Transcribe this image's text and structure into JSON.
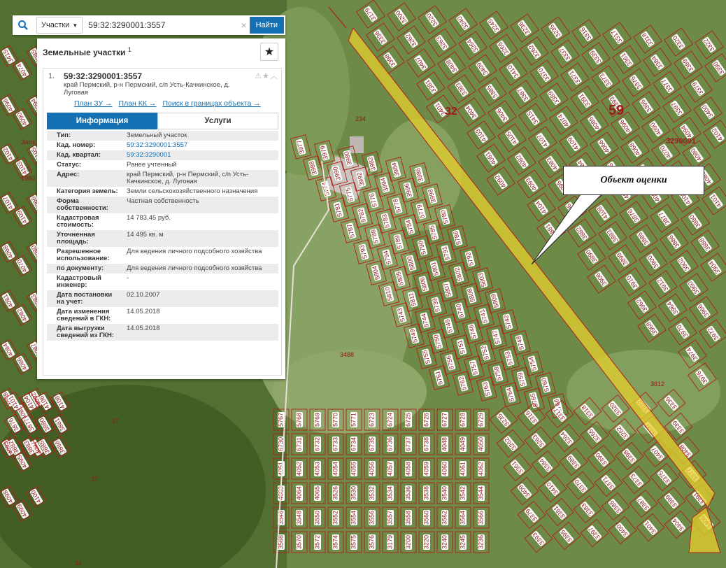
{
  "map": {
    "labels": {
      "quarter_32": "32",
      "quarter_59": "59",
      "quarter_code": "3290001",
      "parcel_234": "234",
      "parcel_3488": "3488",
      "parcel_3812": "3812",
      "parcel_37a": "37",
      "parcel_37b": "37",
      "parcel_34": "34",
      "parcel_5": "5",
      "parcel_1980": "1980",
      "parcel_zaoz": "Заоз"
    },
    "parcel_numbers": [
      "3179",
      "3200",
      "3220",
      "3240",
      "3245",
      "3236",
      "3235",
      "3316",
      "3317",
      "3318",
      "3320",
      "3322",
      "3336",
      "3262",
      "3263",
      "3264",
      "3265",
      "3262",
      "3337",
      "3339",
      "3361",
      "3384",
      "3389",
      "3390",
      "3398",
      "3407",
      "3408",
      "3409",
      "3410",
      "3370",
      "3371",
      "3373",
      "3375",
      "3377",
      "3379",
      "3381",
      "3383",
      "3385",
      "3387",
      "3389",
      "3391",
      "3393",
      "3395",
      "3397",
      "3400",
      "3401",
      "3404",
      "3406",
      "3415",
      "4074",
      "4085",
      "4096",
      "4090",
      "4094",
      "4102",
      "4103",
      "4105",
      "4107",
      "4109",
      "4066",
      "4068",
      "4070",
      "4080",
      "4081",
      "4082",
      "4083",
      "4084",
      "4086",
      "4087",
      "4088",
      "4089",
      "4092",
      "4093",
      "4095",
      "4097",
      "4098",
      "4099",
      "4100",
      "4101",
      "4104",
      "4106",
      "4108",
      "3876",
      "3877",
      "3880",
      "3881",
      "3882",
      "3883",
      "3885",
      "3886",
      "3888",
      "3890",
      "3898",
      "3900",
      "3902",
      "3904",
      "3906",
      "3910",
      "3912",
      "3960",
      "3962",
      "3964",
      "3966",
      "3968",
      "3970",
      "3972",
      "3974",
      "3976",
      "3977",
      "3979",
      "3980",
      "3982",
      "3984",
      "3986",
      "3988",
      "3990",
      "3992",
      "3994",
      "3996",
      "3998",
      "5774",
      "5775",
      "5776",
      "5778",
      "5779",
      "5780",
      "5781",
      "5782",
      "5783",
      "5784",
      "5785",
      "5786",
      "5787",
      "5788",
      "5789",
      "5790",
      "5791",
      "5792",
      "5793",
      "5794",
      "5800",
      "5801",
      "5802",
      "5803",
      "5804",
      "5805",
      "5806",
      "5807",
      "5808",
      "5809",
      "5810",
      "5811",
      "5739",
      "5740",
      "5741",
      "5742",
      "5743",
      "5744",
      "5745",
      "5746",
      "5747",
      "5748",
      "5749",
      "5750",
      "5751",
      "5752",
      "5753",
      "5754",
      "5755",
      "5756",
      "5757",
      "5758",
      "5759",
      "5760",
      "5761",
      "5762",
      "5763",
      "5764",
      "5765",
      "5766",
      "5767",
      "5768",
      "5769",
      "5770",
      "5771",
      "6723",
      "6724",
      "6725",
      "6726",
      "6727",
      "6728",
      "6729",
      "6730",
      "6731",
      "6732",
      "6733",
      "6734",
      "6735",
      "6736",
      "6737",
      "6738",
      "4048",
      "4049",
      "4050",
      "4051",
      "4052",
      "4053",
      "4054",
      "4055",
      "4056",
      "4057",
      "4058",
      "4059",
      "4060",
      "4061",
      "4062",
      "4063",
      "4064",
      "4065",
      "3526",
      "3530",
      "3532",
      "3534",
      "3536",
      "3538",
      "3540",
      "3542",
      "3544",
      "3546",
      "3548",
      "3550",
      "3552",
      "3554",
      "3556",
      "3557",
      "3558",
      "3560",
      "3562",
      "3564",
      "3566",
      "3568",
      "3570",
      "3572",
      "3574",
      "3575",
      "3576"
    ],
    "callout_text": "Объект оценки"
  },
  "search": {
    "type_label": "Участки",
    "query": "59:32:3290001:3557",
    "find_label": "Найти"
  },
  "panel": {
    "heading": "Земельные участки",
    "heading_count": "1",
    "item_index": "1.",
    "cadastral_number": "59:32:3290001:3557",
    "address_short": "край Пермский, р-н Пермский, с/п Усть-Качкинское, д. Луговая",
    "links": {
      "plan_zu": "План ЗУ →",
      "plan_kk": "План КК →",
      "search_bounds": "Поиск в границах объекта →"
    },
    "tabs": {
      "info": "Информация",
      "services": "Услуги"
    },
    "rows": [
      {
        "label": "Тип:",
        "value": "Земельный участок",
        "link": false
      },
      {
        "label": "Кад. номер:",
        "value": "59:32:3290001:3557",
        "link": true
      },
      {
        "label": "Кад. квартал:",
        "value": "59:32:3290001",
        "link": true
      },
      {
        "label": "Статус:",
        "value": "Ранее учтенный",
        "link": false
      },
      {
        "label": "Адрес:",
        "value": "край Пермский, р-н Пермский, с/п Усть-Качкинское, д. Луговая",
        "link": false
      },
      {
        "label": "Категория земель:",
        "value": "Земли сельскохозяйственного назначения",
        "link": false
      },
      {
        "label": "Форма собственности:",
        "value": "Частная собственность",
        "link": false
      },
      {
        "label": "Кадастровая стоимость:",
        "value": "14 783,45 руб.",
        "link": false
      },
      {
        "label": "Уточненная площадь:",
        "value": "14 495 кв. м",
        "link": false
      },
      {
        "label": "Разрешенное использование:",
        "value": "Для ведения личного подсобного хозяйства",
        "link": false
      },
      {
        "label": "по документу:",
        "value": "Для ведения личного подсобного хозяйства",
        "link": false
      },
      {
        "label": "Кадастровый инженер:",
        "value": "-",
        "link": false
      },
      {
        "label": "Дата постановки на учет:",
        "value": "02.10.2007",
        "link": false
      },
      {
        "label": "Дата изменения сведений в ГКН:",
        "value": "14.05.2018",
        "link": false
      },
      {
        "label": "Дата выгрузки сведений из ГКН:",
        "value": "14.05.2018",
        "link": false
      }
    ]
  },
  "colors": {
    "parcel_outline": "#b01e1e",
    "highlight": "#e6cf2c",
    "accent": "#1671b4"
  },
  "icons": {
    "search": "search-icon",
    "favorite": "star-icon",
    "clear": "close-icon",
    "dropdown": "chevron-down-icon",
    "warning": "warning-icon",
    "collapse": "chevron-up-icon"
  }
}
